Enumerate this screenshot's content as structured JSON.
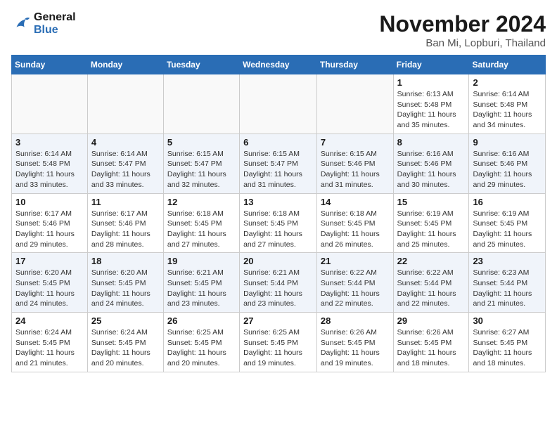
{
  "logo": {
    "line1": "General",
    "line2": "Blue"
  },
  "title": "November 2024",
  "location": "Ban Mi, Lopburi, Thailand",
  "weekdays": [
    "Sunday",
    "Monday",
    "Tuesday",
    "Wednesday",
    "Thursday",
    "Friday",
    "Saturday"
  ],
  "weeks": [
    [
      {
        "day": "",
        "info": ""
      },
      {
        "day": "",
        "info": ""
      },
      {
        "day": "",
        "info": ""
      },
      {
        "day": "",
        "info": ""
      },
      {
        "day": "",
        "info": ""
      },
      {
        "day": "1",
        "info": "Sunrise: 6:13 AM\nSunset: 5:48 PM\nDaylight: 11 hours and 35 minutes."
      },
      {
        "day": "2",
        "info": "Sunrise: 6:14 AM\nSunset: 5:48 PM\nDaylight: 11 hours and 34 minutes."
      }
    ],
    [
      {
        "day": "3",
        "info": "Sunrise: 6:14 AM\nSunset: 5:48 PM\nDaylight: 11 hours and 33 minutes."
      },
      {
        "day": "4",
        "info": "Sunrise: 6:14 AM\nSunset: 5:47 PM\nDaylight: 11 hours and 33 minutes."
      },
      {
        "day": "5",
        "info": "Sunrise: 6:15 AM\nSunset: 5:47 PM\nDaylight: 11 hours and 32 minutes."
      },
      {
        "day": "6",
        "info": "Sunrise: 6:15 AM\nSunset: 5:47 PM\nDaylight: 11 hours and 31 minutes."
      },
      {
        "day": "7",
        "info": "Sunrise: 6:15 AM\nSunset: 5:46 PM\nDaylight: 11 hours and 31 minutes."
      },
      {
        "day": "8",
        "info": "Sunrise: 6:16 AM\nSunset: 5:46 PM\nDaylight: 11 hours and 30 minutes."
      },
      {
        "day": "9",
        "info": "Sunrise: 6:16 AM\nSunset: 5:46 PM\nDaylight: 11 hours and 29 minutes."
      }
    ],
    [
      {
        "day": "10",
        "info": "Sunrise: 6:17 AM\nSunset: 5:46 PM\nDaylight: 11 hours and 29 minutes."
      },
      {
        "day": "11",
        "info": "Sunrise: 6:17 AM\nSunset: 5:46 PM\nDaylight: 11 hours and 28 minutes."
      },
      {
        "day": "12",
        "info": "Sunrise: 6:18 AM\nSunset: 5:45 PM\nDaylight: 11 hours and 27 minutes."
      },
      {
        "day": "13",
        "info": "Sunrise: 6:18 AM\nSunset: 5:45 PM\nDaylight: 11 hours and 27 minutes."
      },
      {
        "day": "14",
        "info": "Sunrise: 6:18 AM\nSunset: 5:45 PM\nDaylight: 11 hours and 26 minutes."
      },
      {
        "day": "15",
        "info": "Sunrise: 6:19 AM\nSunset: 5:45 PM\nDaylight: 11 hours and 25 minutes."
      },
      {
        "day": "16",
        "info": "Sunrise: 6:19 AM\nSunset: 5:45 PM\nDaylight: 11 hours and 25 minutes."
      }
    ],
    [
      {
        "day": "17",
        "info": "Sunrise: 6:20 AM\nSunset: 5:45 PM\nDaylight: 11 hours and 24 minutes."
      },
      {
        "day": "18",
        "info": "Sunrise: 6:20 AM\nSunset: 5:45 PM\nDaylight: 11 hours and 24 minutes."
      },
      {
        "day": "19",
        "info": "Sunrise: 6:21 AM\nSunset: 5:45 PM\nDaylight: 11 hours and 23 minutes."
      },
      {
        "day": "20",
        "info": "Sunrise: 6:21 AM\nSunset: 5:44 PM\nDaylight: 11 hours and 23 minutes."
      },
      {
        "day": "21",
        "info": "Sunrise: 6:22 AM\nSunset: 5:44 PM\nDaylight: 11 hours and 22 minutes."
      },
      {
        "day": "22",
        "info": "Sunrise: 6:22 AM\nSunset: 5:44 PM\nDaylight: 11 hours and 22 minutes."
      },
      {
        "day": "23",
        "info": "Sunrise: 6:23 AM\nSunset: 5:44 PM\nDaylight: 11 hours and 21 minutes."
      }
    ],
    [
      {
        "day": "24",
        "info": "Sunrise: 6:24 AM\nSunset: 5:45 PM\nDaylight: 11 hours and 21 minutes."
      },
      {
        "day": "25",
        "info": "Sunrise: 6:24 AM\nSunset: 5:45 PM\nDaylight: 11 hours and 20 minutes."
      },
      {
        "day": "26",
        "info": "Sunrise: 6:25 AM\nSunset: 5:45 PM\nDaylight: 11 hours and 20 minutes."
      },
      {
        "day": "27",
        "info": "Sunrise: 6:25 AM\nSunset: 5:45 PM\nDaylight: 11 hours and 19 minutes."
      },
      {
        "day": "28",
        "info": "Sunrise: 6:26 AM\nSunset: 5:45 PM\nDaylight: 11 hours and 19 minutes."
      },
      {
        "day": "29",
        "info": "Sunrise: 6:26 AM\nSunset: 5:45 PM\nDaylight: 11 hours and 18 minutes."
      },
      {
        "day": "30",
        "info": "Sunrise: 6:27 AM\nSunset: 5:45 PM\nDaylight: 11 hours and 18 minutes."
      }
    ]
  ]
}
